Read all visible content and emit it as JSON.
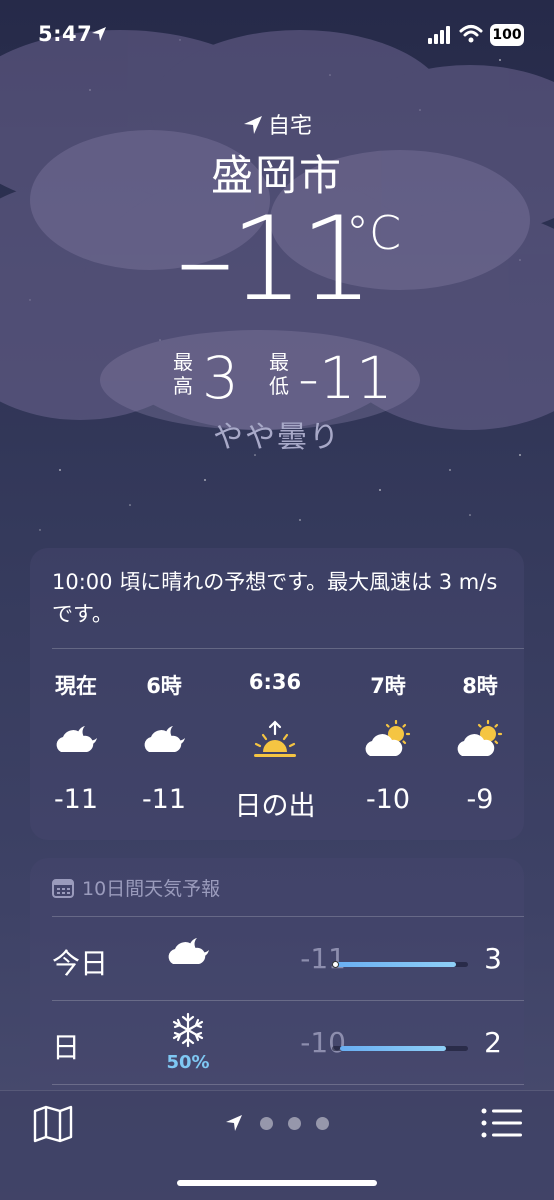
{
  "status_bar": {
    "time": "5:47",
    "battery": "100"
  },
  "location": {
    "label": "自宅",
    "city": "盛岡市",
    "temperature": "–11",
    "unit": "°C",
    "high_label": "最高",
    "high": "3",
    "low_label": "最低",
    "low": "-11",
    "condition": "やや曇り"
  },
  "hourly": {
    "summary": "10:00 頃に晴れの予想です。最大風速は 3 m/s です。",
    "items": [
      {
        "time": "現在",
        "icon": "partly-cloudy-night-icon",
        "temp": "-11"
      },
      {
        "time": "6時",
        "icon": "partly-cloudy-night-icon",
        "temp": "-11"
      },
      {
        "time": "6:36",
        "icon": "sunrise-icon",
        "temp": "日の出"
      },
      {
        "time": "7時",
        "icon": "partly-sunny-icon",
        "temp": "-10"
      },
      {
        "time": "8時",
        "icon": "partly-sunny-icon",
        "temp": "-9"
      }
    ]
  },
  "daily": {
    "title": "10日間天気予報",
    "rows": [
      {
        "day": "今日",
        "icon": "partly-cloudy-night-icon",
        "precip": "",
        "low": "-11",
        "high": "3",
        "current_marker": true
      },
      {
        "day": "日",
        "icon": "snowflake-icon",
        "precip": "50%",
        "low": "-10",
        "high": "2",
        "current_marker": false
      }
    ]
  },
  "colors": {
    "accent_bar": "#69aef2",
    "precip": "#7fc8f3",
    "sun": "#f5c542"
  },
  "bottom_bar": {
    "pages": 3
  }
}
